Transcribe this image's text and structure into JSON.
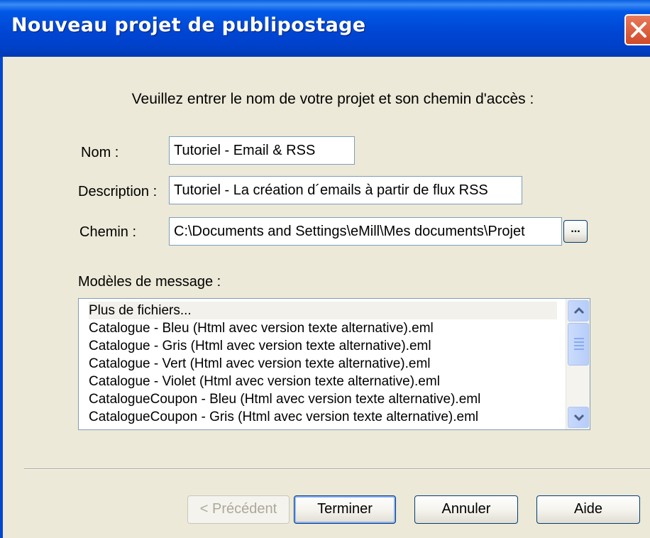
{
  "window": {
    "title": "Nouveau projet de publipostage"
  },
  "prompt": "Veuillez entrer le nom de votre projet et son chemin d'accès :",
  "form": {
    "name_label": "Nom :",
    "name_value": "Tutoriel - Email & RSS",
    "description_label": "Description :",
    "description_value": "Tutoriel - La création d´emails à partir de flux RSS",
    "path_label": "Chemin :",
    "path_value": "C:\\Documents and Settings\\eMill\\Mes documents\\Projet",
    "browse_label": "..."
  },
  "templates": {
    "label": "Modèles de message :",
    "items": [
      "Plus de fichiers...",
      "Catalogue - Bleu (Html avec version texte alternative).eml",
      "Catalogue - Gris (Html avec version texte alternative).eml",
      "Catalogue - Vert (Html avec version texte alternative).eml",
      "Catalogue - Violet (Html avec version texte alternative).eml",
      "CatalogueCoupon - Bleu (Html avec version texte alternative).eml",
      "CatalogueCoupon - Gris (Html avec version texte alternative).eml"
    ]
  },
  "buttons": {
    "previous": "< Précédent",
    "finish": "Terminer",
    "cancel": "Annuler",
    "help": "Aide"
  },
  "colors": {
    "titlebar": "#0046d4",
    "close": "#d9583b",
    "face": "#ece9d8"
  },
  "icons": {
    "close": "close-icon",
    "scroll_up": "chevron-up-icon",
    "scroll_down": "chevron-down-icon"
  }
}
